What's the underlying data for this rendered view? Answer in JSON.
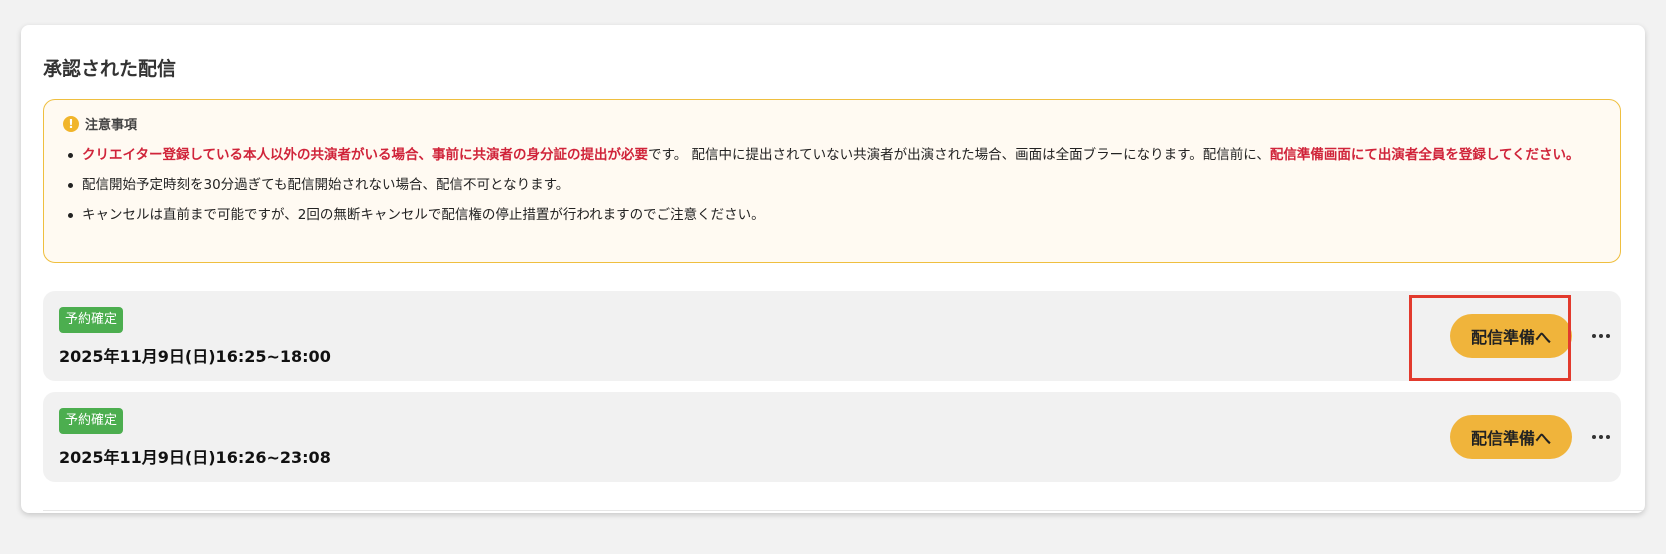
{
  "section": {
    "title": "承認された配信"
  },
  "notice": {
    "title": "注意事項",
    "icon": "alert-circle-icon",
    "accent_color": "#efbf3f",
    "items": [
      {
        "red_1": "クリエイター登録している本人以外の共演者がいる場合、事前に共演者の身分証の提出が必要",
        "text_1": "です。 配信中に提出されていない共演者が出演された場合、画面は全面ブラーになります。配信前に、",
        "red_2": "配信準備画面にて出演者全員を登録してください。"
      },
      {
        "text": "配信開始予定時刻を30分過ぎても配信開始されない場合、配信不可となります。"
      },
      {
        "text": "キャンセルは直前まで可能ですが、2回の無断キャンセルで配信権の停止措置が行われますのでご注意ください。"
      }
    ]
  },
  "streams": [
    {
      "status": "予約確定",
      "datetime": "2025年11月9日(日)16:25~18:00",
      "button_label": "配信準備へ",
      "more_icon": "more-horizontal-icon"
    },
    {
      "status": "予約確定",
      "datetime": "2025年11月9日(日)16:26~23:08",
      "button_label": "配信準備へ",
      "more_icon": "more-horizontal-icon"
    }
  ],
  "colors": {
    "badge_green": "#4cae4f",
    "button_amber": "#f0b43b",
    "warning_red": "#d0243a",
    "highlight_red": "#e23a2d"
  }
}
